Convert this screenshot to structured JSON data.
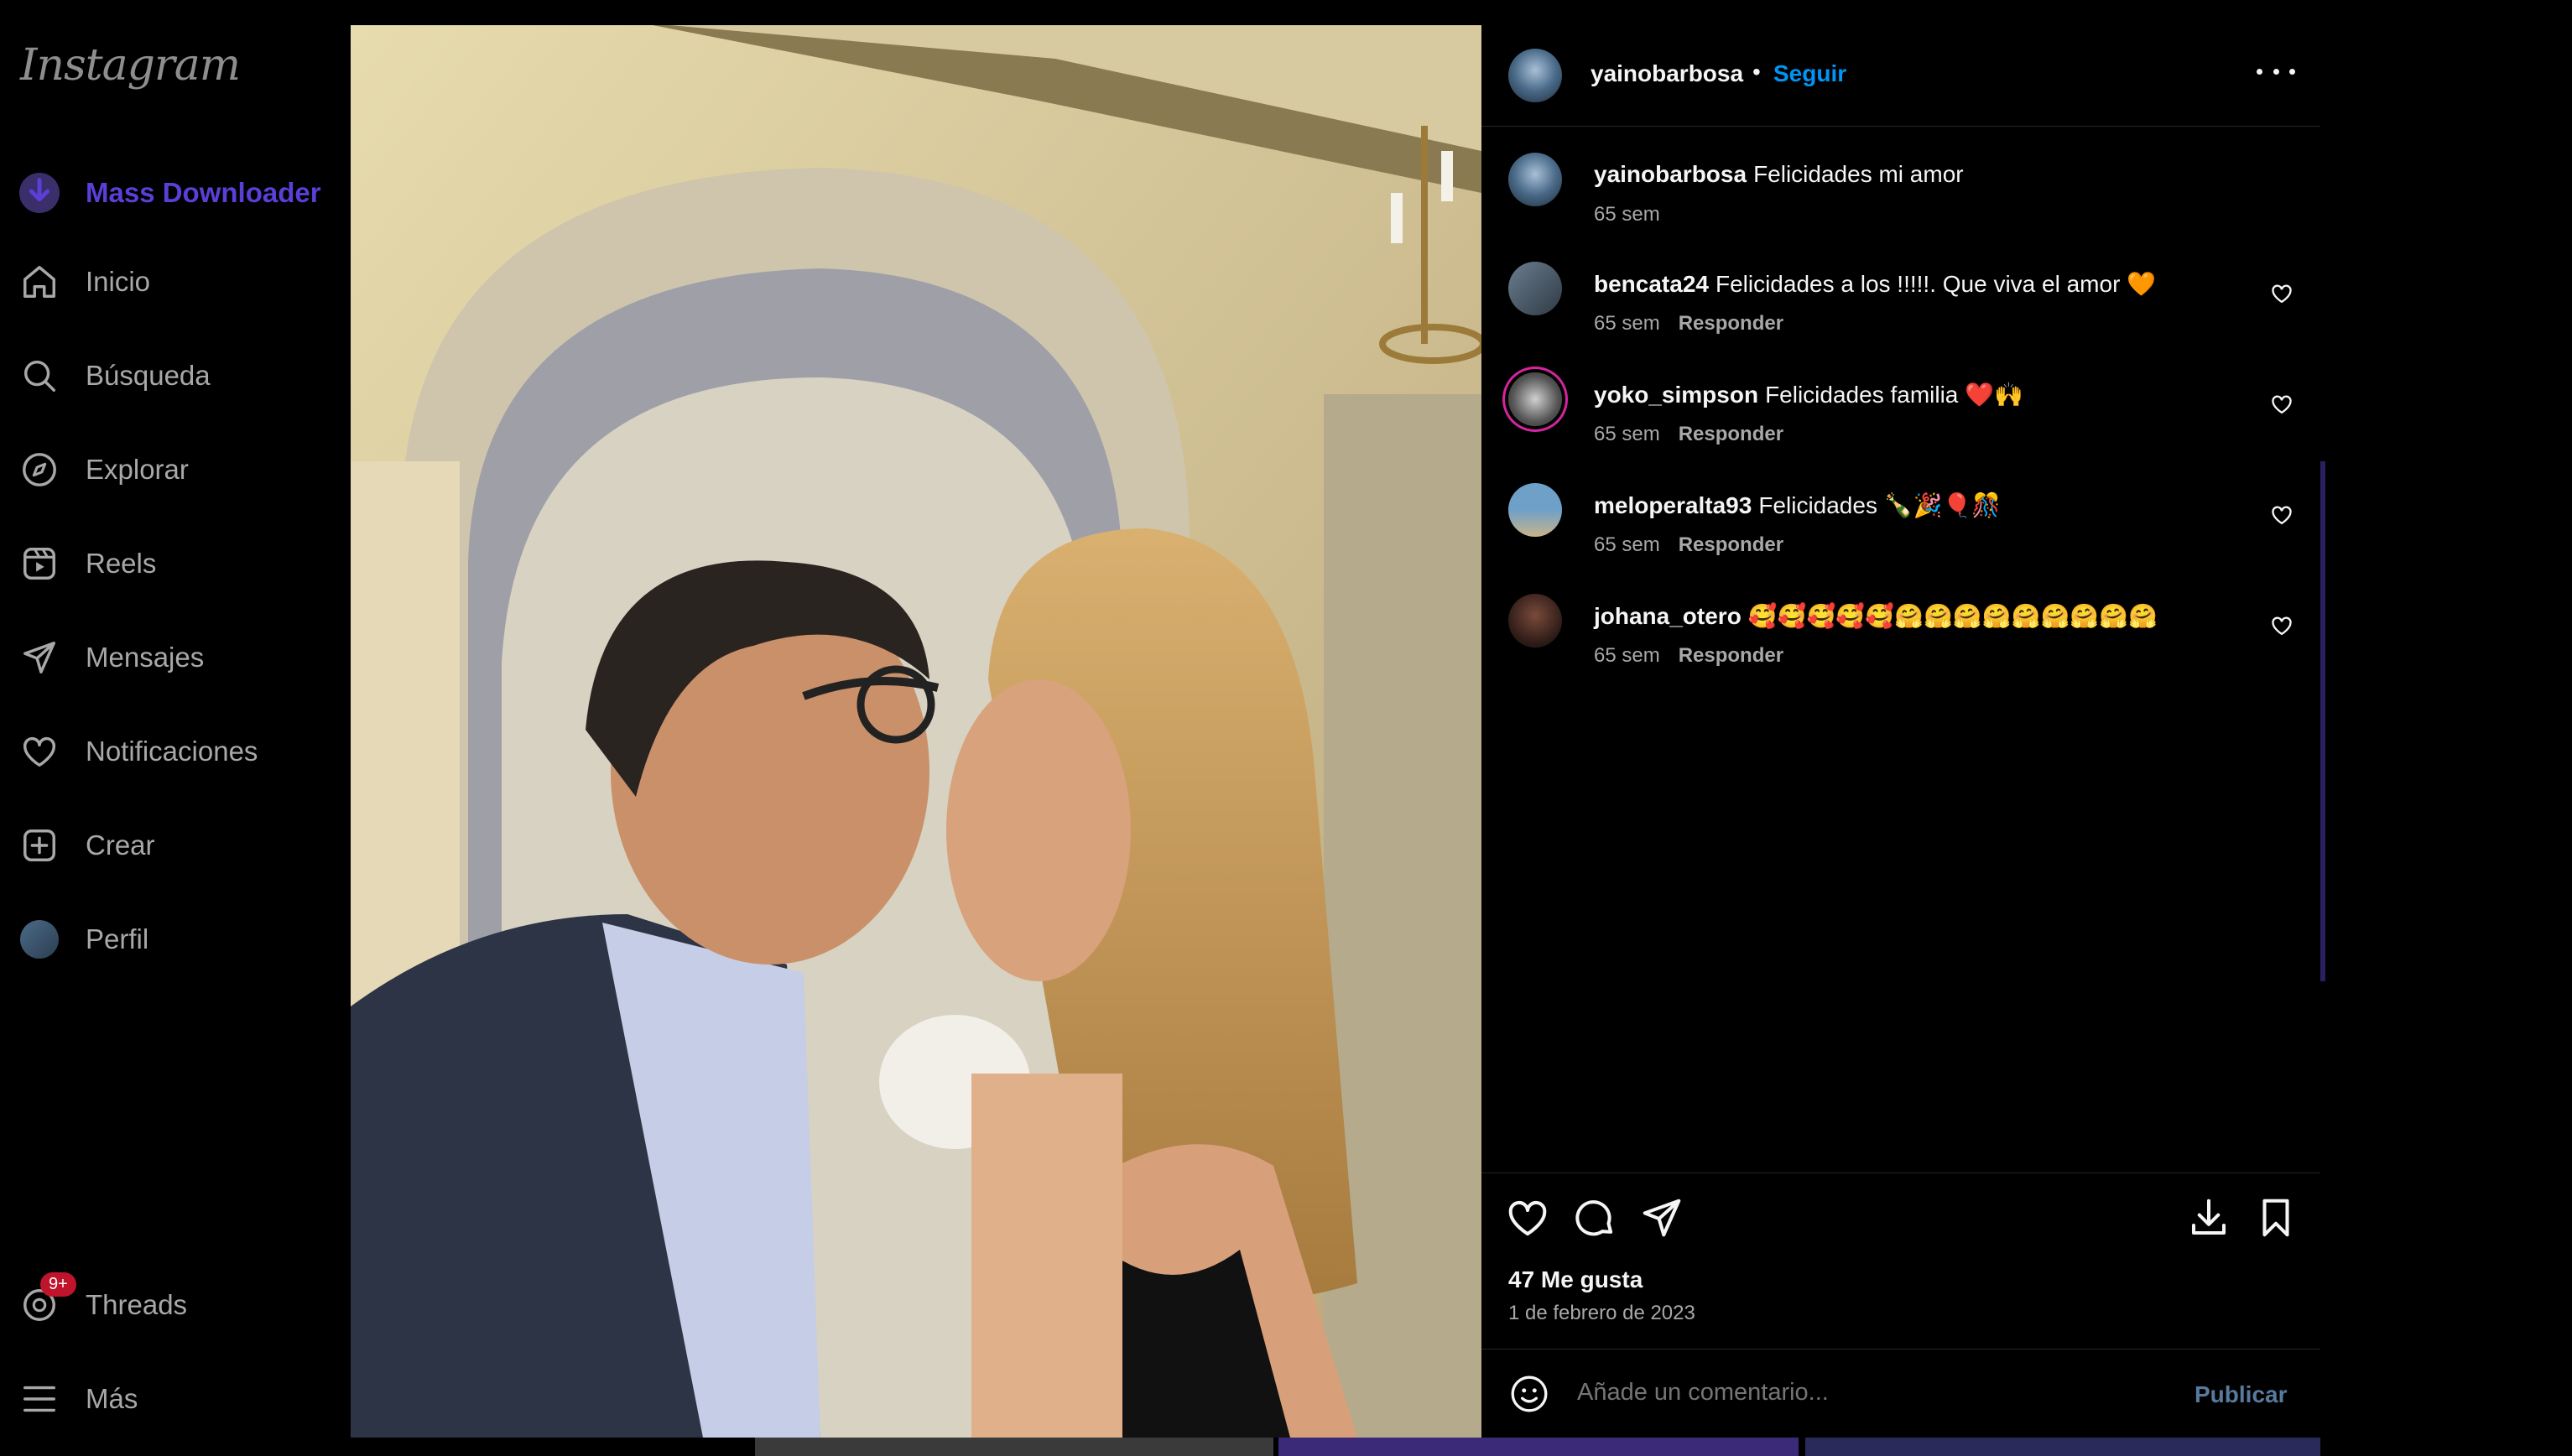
{
  "app": {
    "logo": "Instagram"
  },
  "sidebar": {
    "extension": "Mass Downloader",
    "items": [
      {
        "label": "Inicio",
        "icon": "home-icon"
      },
      {
        "label": "Búsqueda",
        "icon": "search-icon"
      },
      {
        "label": "Explorar",
        "icon": "compass-icon"
      },
      {
        "label": "Reels",
        "icon": "reels-icon"
      },
      {
        "label": "Mensajes",
        "icon": "send-icon"
      },
      {
        "label": "Notificaciones",
        "icon": "heart-icon"
      },
      {
        "label": "Crear",
        "icon": "plus-square-icon"
      },
      {
        "label": "Perfil",
        "icon": "avatar"
      }
    ],
    "threads": {
      "label": "Threads",
      "badge": "9+"
    },
    "more": {
      "label": "Más"
    }
  },
  "post": {
    "author": "yainobarbosa",
    "dot": "•",
    "follow_label": "Seguir",
    "comments": [
      {
        "user": "yainobarbosa",
        "text": "Felicidades mi amor",
        "time": "65 sem",
        "reply": ""
      },
      {
        "user": "bencata24",
        "text": "Felicidades a los !!!!!. Que viva el amor 🧡",
        "time": "65 sem",
        "reply": "Responder"
      },
      {
        "user": "yoko_simpson",
        "text": "Felicidades familia ❤️🙌",
        "time": "65 sem",
        "reply": "Responder"
      },
      {
        "user": "meloperalta93",
        "text": "Felicidades 🍾🎉🎈🎊",
        "time": "65 sem",
        "reply": "Responder"
      },
      {
        "user": "johana_otero",
        "text": "🥰🥰🥰🥰🥰🤗🤗🤗🤗🤗🤗🤗🤗🤗",
        "time": "65 sem",
        "reply": "Responder"
      }
    ],
    "likes": "47 Me gusta",
    "date": "1 de febrero de 2023",
    "comment_placeholder": "Añade un comentario...",
    "publish_label": "Publicar"
  },
  "colors": {
    "link_blue": "#0095f6",
    "publish_disabled": "#577a9d",
    "extension_purple": "#5b3fd6",
    "badge_red": "#c0142d"
  }
}
